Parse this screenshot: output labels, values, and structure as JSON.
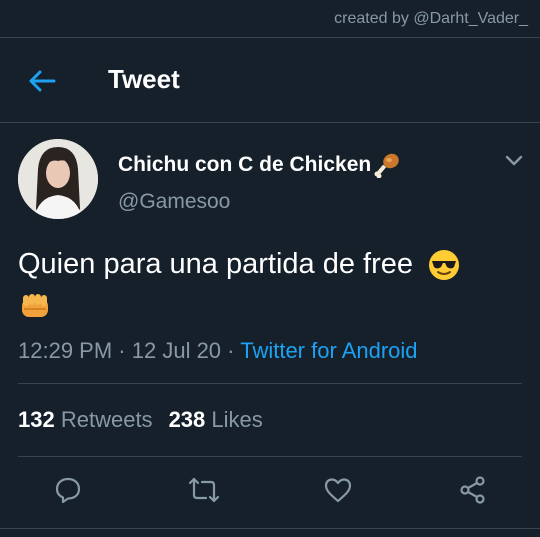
{
  "watermark": "created by @Darht_Vader_",
  "header": {
    "title": "Tweet",
    "back_icon": "arrow-left-icon"
  },
  "tweet": {
    "author_name": "Chichu con C de Chicken",
    "author_handle": "@Gamesoo",
    "text": "Quien para una partida de free",
    "time": "12:29 PM",
    "separator": "·",
    "date": "12 Jul 20",
    "source": "Twitter for Android",
    "retweets_count": "132",
    "retweets_label": "Retweets",
    "likes_count": "238",
    "likes_label": "Likes"
  },
  "actions": [
    {
      "icon": "reply-icon"
    },
    {
      "icon": "retweet-icon"
    },
    {
      "icon": "like-icon"
    },
    {
      "icon": "share-icon"
    }
  ],
  "colors": {
    "background": "#15202b",
    "divider": "#38444d",
    "secondary_text": "#8899a6",
    "accent": "#1da1f2"
  }
}
